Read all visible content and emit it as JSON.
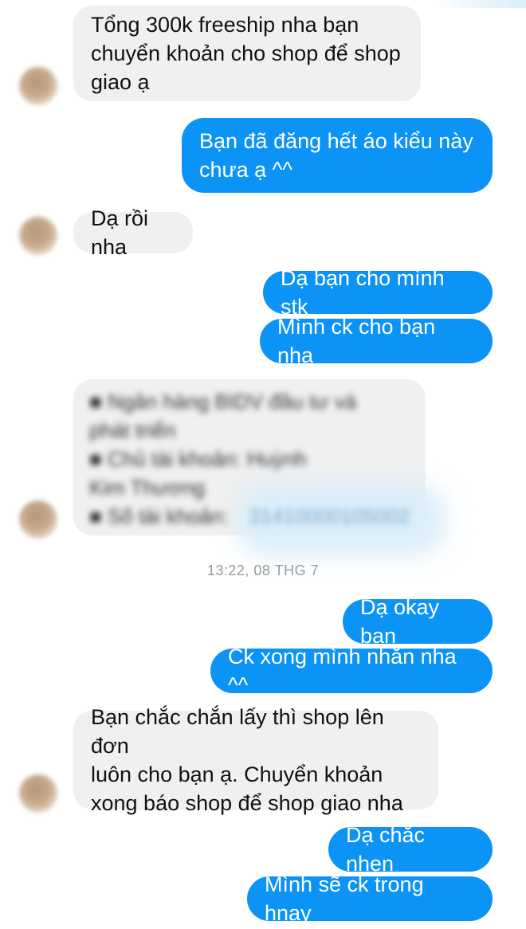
{
  "messages": [
    {
      "text": "Tổng 300k freeship nha bạn\nchuyển khoản cho shop để shop\ngiao ạ"
    },
    {
      "text": "Bạn đã đăng hết áo kiểu này\nchưa ạ ^^"
    },
    {
      "text": "Dạ rồi nha"
    },
    {
      "text": "Dạ bạn cho mình stk"
    },
    {
      "text": "Mình ck cho bạn nha"
    },
    {
      "text": "■ Ngân hàng BIDV đầu tư và\nphát triển\n■ Chủ tài khoản: Huỳnh\nKim Thương\n■ Số tài khoản:"
    },
    {
      "text": "31410000105002"
    },
    {
      "text": "Dạ okay bạn"
    },
    {
      "text": "Ck xong mình nhắn nha ^^"
    },
    {
      "text": "Bạn chắc chắn lấy thì shop lên đơn\nluôn cho bạn ạ. Chuyển khoản\nxong báo shop để shop giao nha"
    },
    {
      "text": "Dạ chắc nhen"
    },
    {
      "text": "Mình sẽ ck trong hnay"
    }
  ],
  "timestamp": "13:22, 08 THG 7",
  "colors": {
    "incoming_bubble": "#f0f0f0",
    "outgoing_bubble": "#0b93f6",
    "outgoing_text": "#ffffff",
    "timestamp_text": "#9a9a9a"
  }
}
